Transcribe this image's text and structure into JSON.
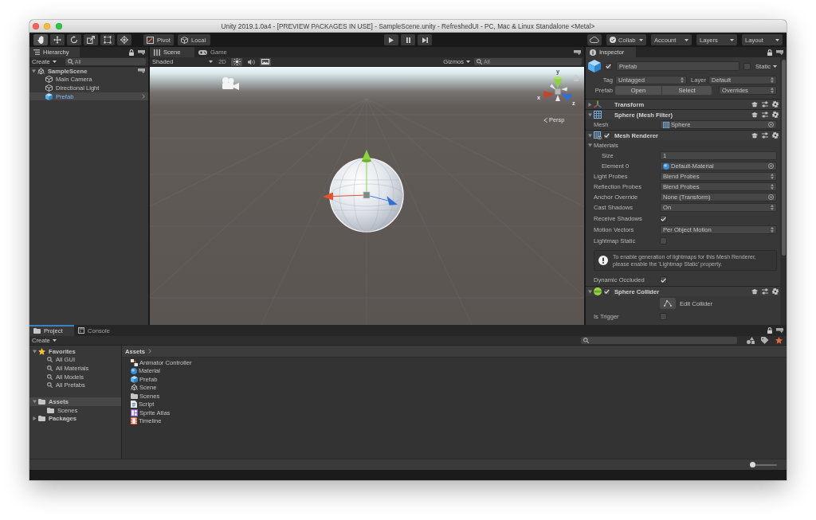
{
  "window": {
    "title": "Unity 2019.1.0a4 - [PREVIEW PACKAGES IN USE] - SampleScene.unity - RefreshedUI - PC, Mac & Linux Standalone <Metal>"
  },
  "toolbar": {
    "tools": [
      {
        "kind": "hand",
        "selected": true
      },
      {
        "kind": "move",
        "selected": false
      },
      {
        "kind": "rotate",
        "selected": false
      },
      {
        "kind": "scale",
        "selected": false
      },
      {
        "kind": "rect",
        "selected": false
      },
      {
        "kind": "transform",
        "selected": false
      }
    ],
    "handle_buttons": [
      {
        "kind": "pivot",
        "label": "Pivot"
      },
      {
        "kind": "space",
        "label": "Local"
      }
    ],
    "collab": {
      "label": "Collab"
    },
    "menus": [
      "Account",
      "Layers",
      "Layout"
    ]
  },
  "hierarchy": {
    "tab": "Hierarchy",
    "focused": false,
    "create": "Create",
    "search": {
      "placeholder": "All"
    },
    "tree": [
      {
        "kind": "scene",
        "label": "SampleScene",
        "expanded": true,
        "selected": false,
        "children": [
          {
            "kind": "object",
            "label": "Main Camera",
            "selected": false
          },
          {
            "kind": "object",
            "label": "Directional Light",
            "selected": false
          },
          {
            "kind": "prefab",
            "label": "Prefab",
            "selected": true
          }
        ]
      }
    ]
  },
  "scene_view": {
    "focused": false,
    "tabs": [
      {
        "kind": "scene",
        "label": "Scene",
        "selected": true
      },
      {
        "kind": "game",
        "label": "Game",
        "selected": false
      }
    ],
    "draw_mode": "Shaded",
    "toggles": [
      {
        "kind": "dimension",
        "label": "2D",
        "on": false
      },
      {
        "kind": "lighting",
        "on": true
      },
      {
        "kind": "audio",
        "on": false
      },
      {
        "kind": "effects",
        "on": true
      }
    ],
    "gizmos": "Gizmos",
    "search": {
      "placeholder": "All"
    },
    "axis_labels": [
      "y",
      "x",
      "z"
    ],
    "projection": "Persp"
  },
  "inspector": {
    "tab": "Inspector",
    "focused": false,
    "object": {
      "name": "Prefab",
      "active": true,
      "static": {
        "label": "Static",
        "checked": false
      }
    },
    "tag": {
      "label": "Tag",
      "value": "Untagged"
    },
    "layer": {
      "label": "Layer",
      "value": "Default"
    },
    "prefab": {
      "label": "Prefab",
      "buttons": [
        "Open",
        "Select"
      ],
      "overrides": "Overrides"
    },
    "components": [
      {
        "kind": "transform",
        "name": "Transform",
        "expanded": false
      },
      {
        "kind": "mesh_filter",
        "name": "Sphere (Mesh Filter)",
        "expanded": true,
        "properties": [
          {
            "kind": "object",
            "label": "Mesh",
            "value": "Sphere",
            "asset": {
              "kind": "mesh"
            }
          }
        ]
      },
      {
        "kind": "mesh_renderer",
        "name": "Mesh Renderer",
        "enabled": true,
        "expanded": true,
        "properties": [
          {
            "kind": "foldout",
            "label": "Materials",
            "expanded": true,
            "children": [
              {
                "kind": "text",
                "label": "Size",
                "value": "1"
              },
              {
                "kind": "object",
                "label": "Element 0",
                "value": "Default-Material",
                "asset": {
                  "kind": "material"
                }
              }
            ]
          },
          {
            "kind": "dropdown",
            "label": "Light Probes",
            "value": "Blend Probes"
          },
          {
            "kind": "dropdown",
            "label": "Reflection Probes",
            "value": "Blend Probes"
          },
          {
            "kind": "object",
            "label": "Anchor Override",
            "value": "None (Transform)"
          },
          {
            "kind": "dropdown",
            "label": "Cast Shadows",
            "value": "On"
          },
          {
            "kind": "toggle",
            "label": "Receive Shadows",
            "checked": true
          },
          {
            "kind": "dropdown",
            "label": "Motion Vectors",
            "value": "Per Object Motion"
          },
          {
            "kind": "toggle",
            "label": "Lightmap Static",
            "checked": false
          },
          {
            "kind": "help",
            "text": "To enable generation of lightmaps for this Mesh Renderer, please enable the 'Lightmap Static' property."
          },
          {
            "kind": "toggle",
            "label": "Dynamic Occluded",
            "checked": true
          }
        ]
      },
      {
        "kind": "sphere_collider",
        "name": "Sphere Collider",
        "enabled": true,
        "expanded": true,
        "properties": [
          {
            "kind": "button",
            "label": "Edit Collider"
          },
          {
            "kind": "toggle",
            "label": "Is Trigger",
            "checked": false
          }
        ]
      }
    ]
  },
  "project": {
    "focused": true,
    "tabs": [
      {
        "kind": "project",
        "label": "Project",
        "selected": true
      },
      {
        "kind": "console",
        "label": "Console",
        "selected": false
      }
    ],
    "create": "Create",
    "tree": [
      {
        "kind": "favorites",
        "label": "Favorites",
        "expanded": true,
        "selected": false,
        "children": [
          {
            "kind": "search",
            "label": "All GUI",
            "selected": false
          },
          {
            "kind": "search",
            "label": "All Materials",
            "selected": false
          },
          {
            "kind": "search",
            "label": "All Models",
            "selected": false
          },
          {
            "kind": "search",
            "label": "All Prefabs",
            "selected": false
          }
        ]
      },
      {
        "kind": "folder",
        "label": "Assets",
        "expanded": true,
        "selected": true,
        "children": [
          {
            "kind": "folder",
            "label": "Scenes",
            "selected": false
          }
        ]
      },
      {
        "kind": "folder",
        "label": "Packages",
        "expanded": false,
        "selected": false
      }
    ],
    "breadcrumb": "Assets",
    "assets": [
      {
        "kind": "animator",
        "label": "Animator Controller"
      },
      {
        "kind": "material",
        "label": "Material"
      },
      {
        "kind": "prefab",
        "label": "Prefab"
      },
      {
        "kind": "scene",
        "label": "Scene"
      },
      {
        "kind": "folder",
        "label": "Scenes"
      },
      {
        "kind": "script",
        "label": "Script"
      },
      {
        "kind": "atlas",
        "label": "Sprite Atlas"
      },
      {
        "kind": "timeline",
        "label": "Timeline"
      }
    ],
    "size_slider": {
      "level": 0
    }
  }
}
